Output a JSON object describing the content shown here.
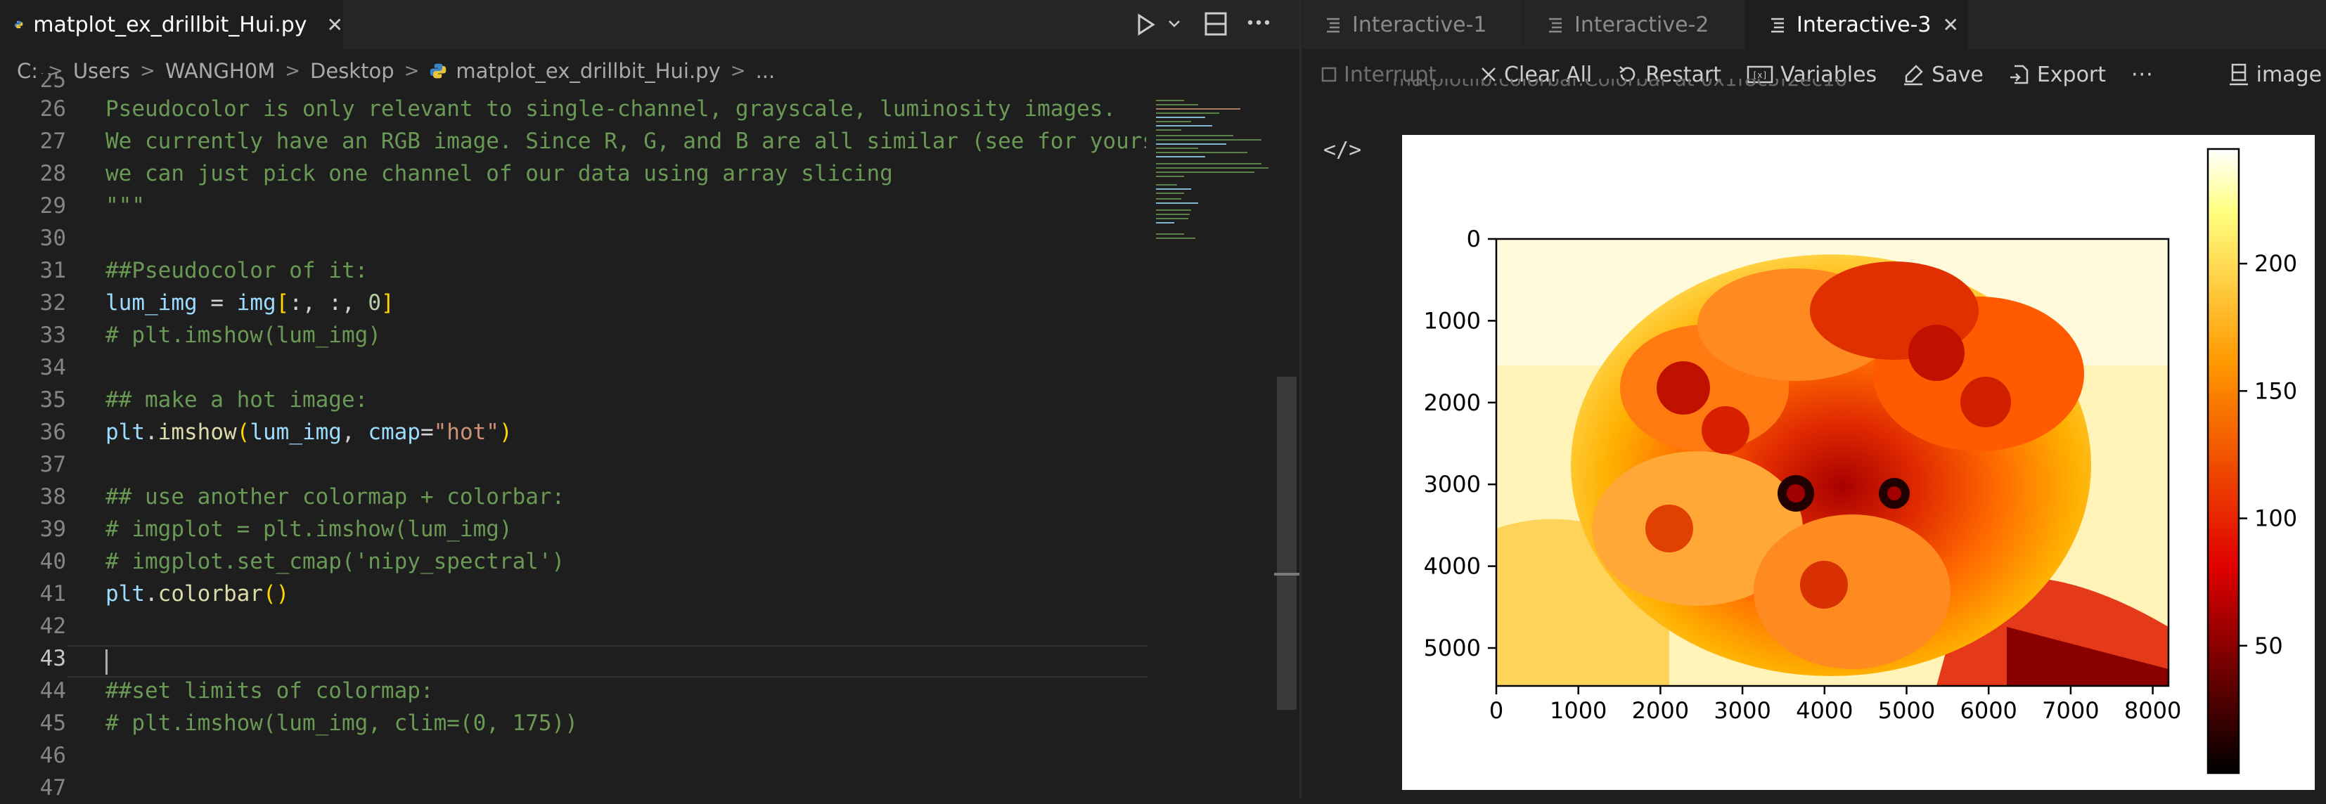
{
  "editor": {
    "tab": {
      "filename": "matplot_ex_drillbit_Hui.py",
      "close": "✕"
    },
    "toolbar_icons": [
      "run-icon",
      "chevron-down-icon",
      "split-editor-icon",
      "more-icon"
    ],
    "breadcrumbs": [
      "C:",
      "Users",
      "WANGH0M",
      "Desktop",
      "matplot_ex_drillbit_Hui.py",
      "..."
    ],
    "partial_line_number": "25",
    "lines": [
      {
        "n": "26",
        "text": "Pseudocolor is only relevant to single-channel, grayscale, luminosity images."
      },
      {
        "n": "27",
        "text": "We currently have an RGB image. Since R, G, and B are all similar (see for yourse"
      },
      {
        "n": "28",
        "text": "we can just pick one channel of our data using array slicing"
      },
      {
        "n": "29",
        "text": "\"\"\""
      },
      {
        "n": "30",
        "text": ""
      },
      {
        "n": "31",
        "text": "##Pseudocolor of it:"
      },
      {
        "n": "32",
        "text": "lum_img = img[:, :, 0]"
      },
      {
        "n": "33",
        "text": "# plt.imshow(lum_img)"
      },
      {
        "n": "34",
        "text": ""
      },
      {
        "n": "35",
        "text": "## make a hot image:"
      },
      {
        "n": "36",
        "text": "plt.imshow(lum_img, cmap=\"hot\")"
      },
      {
        "n": "37",
        "text": ""
      },
      {
        "n": "38",
        "text": "## use another colormap + colorbar:"
      },
      {
        "n": "39",
        "text": "# imgplot = plt.imshow(lum_img)"
      },
      {
        "n": "40",
        "text": "# imgplot.set_cmap('nipy_spectral')"
      },
      {
        "n": "41",
        "text": "plt.colorbar()"
      },
      {
        "n": "42",
        "text": ""
      },
      {
        "n": "43",
        "text": ""
      },
      {
        "n": "44",
        "text": "##set limits of colormap:"
      },
      {
        "n": "45",
        "text": "# plt.imshow(lum_img, clim=(0, 175))"
      },
      {
        "n": "46",
        "text": ""
      },
      {
        "n": "47",
        "text": ""
      }
    ],
    "current_line": "43"
  },
  "interactive": {
    "tabs": [
      {
        "label": "Interactive-1",
        "active": false
      },
      {
        "label": "Interactive-2",
        "active": false
      },
      {
        "label": "Interactive-3",
        "active": true
      }
    ],
    "tab_close": "✕",
    "toolbar": {
      "interrupt": "Interrupt",
      "clear_all": "Clear All",
      "restart": "Restart",
      "variables": "Variables",
      "save": "Save",
      "export": "Export",
      "more": "···",
      "kernel": "image"
    },
    "truncated_output": "matplotlib.colorbar.Colorbar at 0x1f8c5f2ec10",
    "code_toggle": "</>"
  },
  "chart_data": {
    "type": "heatmap",
    "description_colormap": "hot",
    "x_ticks": [
      "0",
      "1000",
      "2000",
      "3000",
      "4000",
      "5000",
      "6000",
      "7000",
      "8000"
    ],
    "y_ticks": [
      "0",
      "1000",
      "2000",
      "3000",
      "4000",
      "5000"
    ],
    "xlim": [
      0,
      8192
    ],
    "ylim": [
      5464,
      0
    ],
    "colorbar_ticks": [
      "50",
      "100",
      "150",
      "200"
    ],
    "colorbar_range": [
      0,
      245
    ],
    "colors": {
      "low": "#000000",
      "mid1": "#e00000",
      "mid2": "#ff9900",
      "high": "#ffff80",
      "top": "#ffffff"
    }
  }
}
